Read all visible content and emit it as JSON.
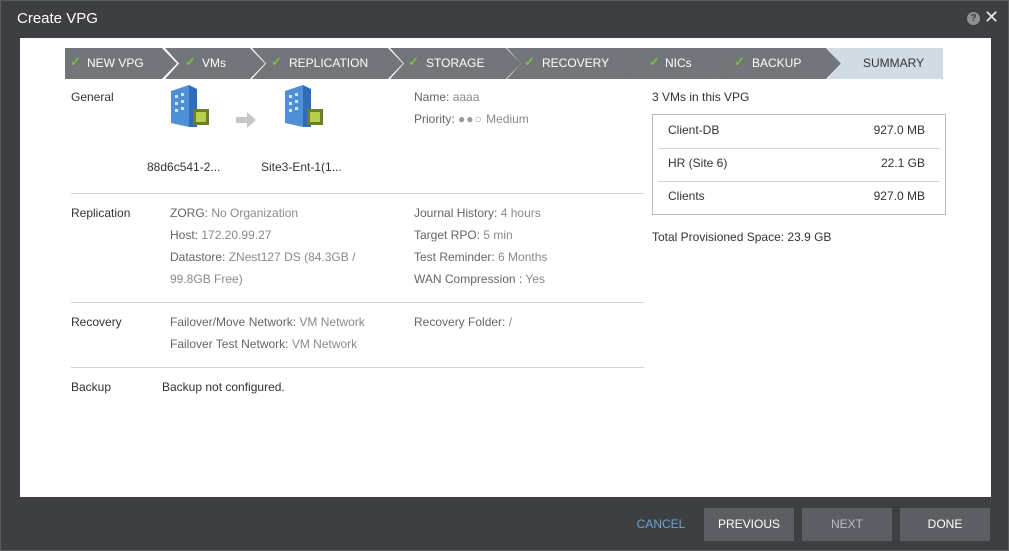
{
  "window": {
    "title": "Create VPG"
  },
  "steps": [
    {
      "label": "NEW VPG",
      "done": true
    },
    {
      "label": "VMs",
      "done": true
    },
    {
      "label": "REPLICATION",
      "done": true
    },
    {
      "label": "STORAGE",
      "done": true
    },
    {
      "label": "RECOVERY",
      "done": true
    },
    {
      "label": "NICs",
      "done": true
    },
    {
      "label": "BACKUP",
      "done": true
    },
    {
      "label": "SUMMARY",
      "done": false
    }
  ],
  "general": {
    "heading": "General",
    "source_site": "88d6c541-2...",
    "target_site": "Site3-Ent-1(1...",
    "name_label": "Name:",
    "name_value": "aaaa",
    "priority_label": "Priority:",
    "priority_value": "Medium"
  },
  "replication": {
    "heading": "Replication",
    "zorg_label": "ZORG:",
    "zorg_value": "No Organization",
    "host_label": "Host:",
    "host_value": "172.20.99.27",
    "datastore_label": "Datastore:",
    "datastore_value_1": "ZNest127 DS (84.3GB /",
    "datastore_value_2": "99.8GB Free)",
    "journal_label": "Journal History:",
    "journal_value": "4 hours",
    "rpo_label": "Target RPO:",
    "rpo_value": "5 min",
    "reminder_label": "Test Reminder:",
    "reminder_value": "6 Months",
    "wan_label": "WAN Compression :",
    "wan_value": "Yes"
  },
  "recovery": {
    "heading": "Recovery",
    "failover_label": "Failover/Move Network:",
    "failover_value": "VM Network",
    "test_label": "Failover Test Network:",
    "test_value": "VM Network",
    "folder_label": "Recovery Folder:",
    "folder_value": "/"
  },
  "backup": {
    "heading": "Backup",
    "value": "Backup not configured."
  },
  "vms": {
    "heading": "3 VMs in this VPG",
    "items": [
      {
        "name": "Client-DB",
        "size": "927.0 MB"
      },
      {
        "name": "HR (Site 6)",
        "size": "22.1 GB"
      },
      {
        "name": "Clients",
        "size": "927.0 MB"
      }
    ],
    "total": "Total Provisioned Space: 23.9 GB"
  },
  "footer": {
    "cancel": "CANCEL",
    "previous": "PREVIOUS",
    "next": "NEXT",
    "done": "DONE"
  },
  "colors": {
    "step_active": "#727579",
    "step_current": "#d0dbe3",
    "check": "#7bc043",
    "accent": "#6aa7d6"
  }
}
